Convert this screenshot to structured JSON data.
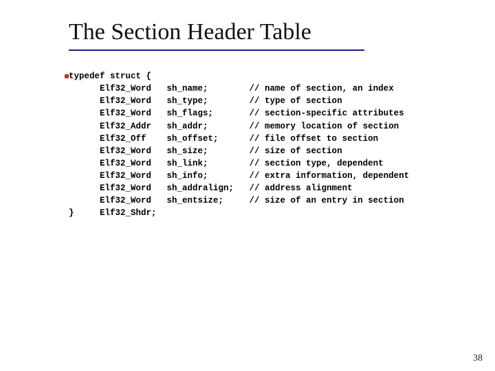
{
  "title": "The Section Header Table",
  "code": {
    "open": "typedef struct {",
    "fields": [
      {
        "type": "Elf32_Word",
        "name": "sh_name;",
        "comment": "// name of section, an index"
      },
      {
        "type": "Elf32_Word",
        "name": "sh_type;",
        "comment": "// type of section"
      },
      {
        "type": "Elf32_Word",
        "name": "sh_flags;",
        "comment": "// section-specific attributes"
      },
      {
        "type": "Elf32_Addr",
        "name": "sh_addr;",
        "comment": "// memory location of section"
      },
      {
        "type": "Elf32_Off",
        "name": "sh_offset;",
        "comment": "// file offset to section"
      },
      {
        "type": "Elf32_Word",
        "name": "sh_size;",
        "comment": "// size of section"
      },
      {
        "type": "Elf32_Word",
        "name": "sh_link;",
        "comment": "// section type, dependent"
      },
      {
        "type": "Elf32_Word",
        "name": "sh_info;",
        "comment": "// extra information, dependent"
      },
      {
        "type": "Elf32_Word",
        "name": "sh_addralign;",
        "comment": "// address alignment"
      },
      {
        "type": "Elf32_Word",
        "name": "sh_entsize;",
        "comment": "// size of an entry in section"
      }
    ],
    "close": "}     Elf32_Shdr;"
  },
  "page_number": "38"
}
